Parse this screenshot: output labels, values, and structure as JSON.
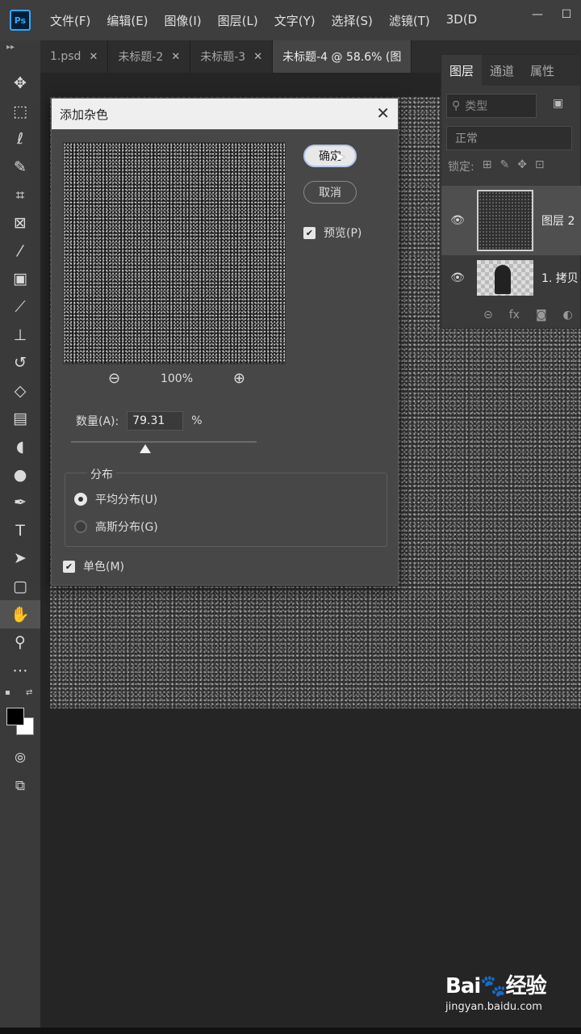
{
  "app": {
    "logo": "Ps"
  },
  "menubar": {
    "items": [
      "文件(F)",
      "编辑(E)",
      "图像(I)",
      "图层(L)",
      "文字(Y)",
      "选择(S)",
      "滤镜(T)",
      "3D(D"
    ]
  },
  "window_controls": {
    "minimize": "—",
    "restore": "☐",
    "close": "✕"
  },
  "tabs": [
    {
      "label": "1.psd",
      "close": "✕"
    },
    {
      "label": "未标题-2",
      "close": "✕"
    },
    {
      "label": "未标题-3",
      "close": "✕"
    },
    {
      "label": "未标题-4 @ 58.6% (图",
      "close": ""
    }
  ],
  "toolbar": {
    "grip": "▸▸",
    "tools": [
      {
        "name": "move-tool",
        "glyph": "✥"
      },
      {
        "name": "marquee-tool",
        "glyph": "⬚"
      },
      {
        "name": "lasso-tool",
        "glyph": "ℓ"
      },
      {
        "name": "quick-select-tool",
        "glyph": "✎"
      },
      {
        "name": "crop-tool",
        "glyph": "⌗"
      },
      {
        "name": "frame-tool",
        "glyph": "⊠"
      },
      {
        "name": "eyedropper-tool",
        "glyph": "⁄"
      },
      {
        "name": "patch-tool",
        "glyph": "▣"
      },
      {
        "name": "brush-tool",
        "glyph": "⟋"
      },
      {
        "name": "stamp-tool",
        "glyph": "⊥"
      },
      {
        "name": "history-brush-tool",
        "glyph": "↺"
      },
      {
        "name": "eraser-tool",
        "glyph": "◇"
      },
      {
        "name": "gradient-tool",
        "glyph": "▤"
      },
      {
        "name": "blur-tool",
        "glyph": "◖"
      },
      {
        "name": "dodge-tool",
        "glyph": "●"
      },
      {
        "name": "pen-tool",
        "glyph": "✒"
      },
      {
        "name": "type-tool",
        "glyph": "T"
      },
      {
        "name": "path-select-tool",
        "glyph": "➤"
      },
      {
        "name": "shape-tool",
        "glyph": "▢"
      },
      {
        "name": "hand-tool",
        "glyph": "✋"
      },
      {
        "name": "zoom-tool",
        "glyph": "⚲"
      },
      {
        "name": "more-tools",
        "glyph": "⋯"
      }
    ],
    "quickmask": "⦾",
    "screenmode": "⧉"
  },
  "layers_panel": {
    "tabs": [
      "图层",
      "通道",
      "属性"
    ],
    "search_placeholder": "类型",
    "search_icon": "⚲",
    "filter_icon": "▣",
    "blend_mode": "正常",
    "lock_label": "锁定:",
    "lock_icons": [
      "⊞",
      "✎",
      "✥",
      "⊡"
    ],
    "layers": [
      {
        "name": "图层 2",
        "eye": "👁"
      },
      {
        "name": "1. 拷贝",
        "eye": "👁"
      }
    ],
    "footer_icons": [
      "⊝",
      "fx",
      "◙",
      "◐"
    ]
  },
  "dialog": {
    "title": "添加杂色",
    "close": "✕",
    "ok_label": "确定",
    "cancel_label": "取消",
    "preview_label": "预览(P)",
    "preview_checked": true,
    "zoom_out": "⊖",
    "zoom_in": "⊕",
    "zoom_level": "100%",
    "amount_label": "数量(A):",
    "amount_value": "79.31",
    "amount_unit": "%",
    "amount_slider_fraction": 0.4,
    "distribution_title": "分布",
    "distribution_options": [
      "平均分布(U)",
      "高斯分布(G)"
    ],
    "distribution_selected": 0,
    "mono_label": "单色(M)",
    "mono_checked": true
  },
  "watermark": {
    "logo": "Bai🐾经验",
    "url": "jingyan.baidu.com"
  }
}
